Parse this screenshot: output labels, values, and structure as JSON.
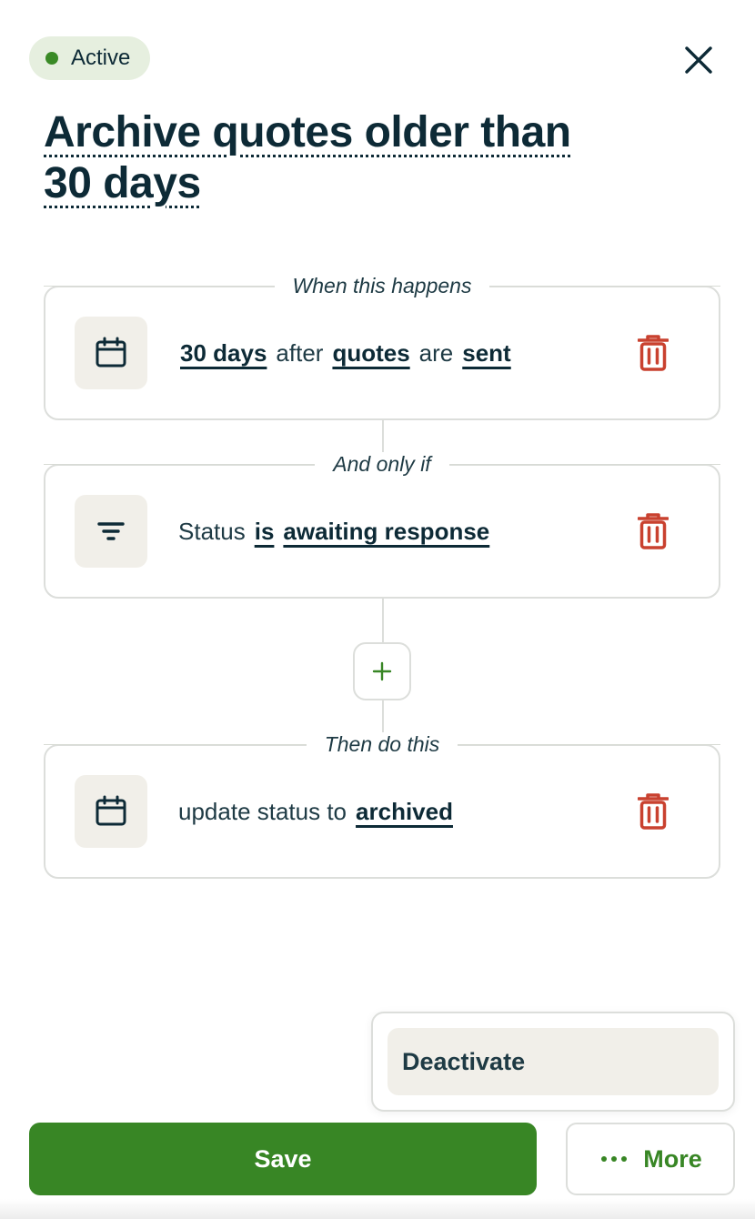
{
  "status": {
    "label": "Active",
    "color": "#3a8a26"
  },
  "title": {
    "line1": "Archive quotes older than",
    "line2": "30 days"
  },
  "sections": {
    "trigger_label": "When this happens",
    "condition_label": "And only if",
    "action_label": "Then do this"
  },
  "trigger": {
    "icon": "calendar-icon",
    "parts": [
      "30 days",
      "after",
      "quotes",
      "are",
      "sent"
    ]
  },
  "condition": {
    "icon": "filter-icon",
    "parts": [
      "Status",
      "is",
      "awaiting response"
    ]
  },
  "action": {
    "icon": "calendar-icon",
    "parts": [
      "update status to",
      "archived"
    ]
  },
  "menu": {
    "deactivate_label": "Deactivate"
  },
  "footer": {
    "save_label": "Save",
    "more_label": "More"
  },
  "colors": {
    "primary_green": "#388625",
    "delete_red": "#c9412f",
    "text_dark": "#0d2a36",
    "icon_bg": "#f1efe9"
  }
}
